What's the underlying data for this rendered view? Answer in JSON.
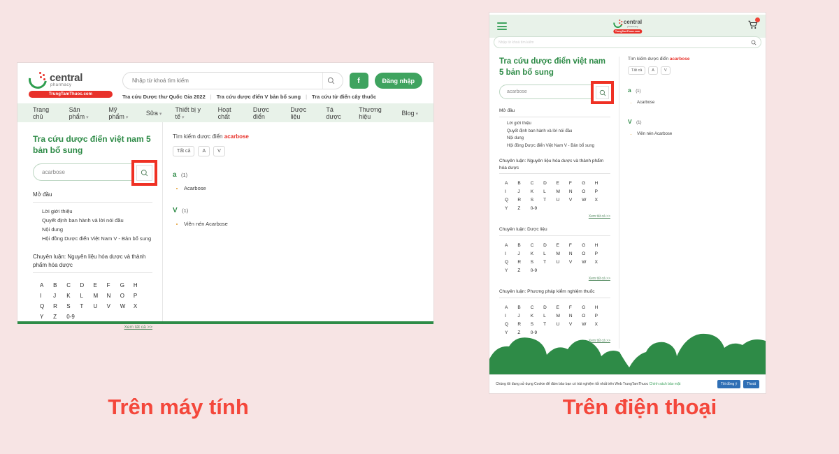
{
  "page": {
    "background_color": "#f7e4e4",
    "accent_green": "#2e8b47",
    "accent_red": "#e8312a",
    "annotation_red": "#ef3124"
  },
  "captions": {
    "desktop": "Trên máy tính",
    "mobile": "Trên điện thoại"
  },
  "brand": {
    "name": "central",
    "tagline": "pharmacy",
    "badge": "TrungTamThuoc.com"
  },
  "desktop": {
    "header": {
      "search_placeholder": "Nhập từ khoá tìm kiếm",
      "search_icon": "search-icon",
      "facebook_label": "f",
      "login_label": "Đăng nhập",
      "sublinks": [
        "Tra cứu Dược thư Quốc Gia 2022",
        "Tra cứu dược điển V bản bổ sung",
        "Tra cứu từ điển cây thuốc"
      ],
      "separator": "|"
    },
    "nav": [
      {
        "label": "Trang chủ",
        "caret": false
      },
      {
        "label": "Sản phẩm",
        "caret": true
      },
      {
        "label": "Mỹ phẩm",
        "caret": true
      },
      {
        "label": "Sữa",
        "caret": true
      },
      {
        "label": "Thiết bị y tế",
        "caret": true
      },
      {
        "label": "Hoạt chất",
        "caret": false
      },
      {
        "label": "Dược điển",
        "caret": false
      },
      {
        "label": "Dược liệu",
        "caret": false
      },
      {
        "label": "Tá dược",
        "caret": false
      },
      {
        "label": "Thương hiệu",
        "caret": false
      },
      {
        "label": "Blog",
        "caret": true
      }
    ],
    "left_panel": {
      "title": "Tra cứu dược điển việt nam 5 bản bổ sung",
      "search_value": "acarbose",
      "search_icon": "search-icon",
      "intro_heading": "Mở đầu",
      "intro_items": [
        "Lời giới thiệu",
        "Quyết định ban hành và lời nói đầu",
        "Nội dung",
        "Hội đồng Dược điển Việt Nam V - Bản bổ sung"
      ],
      "monograph_heading": "Chuyên luận: Nguyên liệu hóa dược và thành phẩm hóa dược",
      "alphabet": [
        "A",
        "B",
        "C",
        "D",
        "E",
        "F",
        "G",
        "H",
        "I",
        "J",
        "K",
        "L",
        "M",
        "N",
        "O",
        "P",
        "Q",
        "R",
        "S",
        "T",
        "U",
        "V",
        "W",
        "X",
        "Y",
        "Z",
        "0-9"
      ],
      "see_all": "Xem tất cả >>"
    },
    "right_panel": {
      "result_prefix": "Tìm kiếm dược điển",
      "query": "acarbose",
      "filters": [
        "Tất cả",
        "A",
        "V"
      ],
      "groups": [
        {
          "letter": "a",
          "count": "(1)",
          "items": [
            "Acarbose"
          ]
        },
        {
          "letter": "V",
          "count": "(1)",
          "items": [
            "Viên nén Acarbose"
          ]
        }
      ]
    }
  },
  "mobile": {
    "header": {
      "menu_icon": "hamburger-menu-icon",
      "cart_icon": "shopping-cart-icon",
      "cart_badge": "",
      "search_placeholder": "Nhập từ khoá tìm kiếm",
      "search_icon": "search-icon"
    },
    "left_panel": {
      "title": "Tra cứu dược điển việt nam 5 bản bổ sung",
      "search_value": "acarbose",
      "search_icon": "search-icon",
      "intro_heading": "Mở đầu",
      "intro_items": [
        "Lời giới thiệu",
        "Quyết định ban hành và lời nói đầu",
        "Nội dung",
        "Hội đồng Dược điển Việt Nam V - Bản bổ sung"
      ],
      "alphabet": [
        "A",
        "B",
        "C",
        "D",
        "E",
        "F",
        "G",
        "H",
        "I",
        "J",
        "K",
        "L",
        "M",
        "N",
        "O",
        "P",
        "Q",
        "R",
        "S",
        "T",
        "U",
        "V",
        "W",
        "X",
        "Y",
        "Z",
        "0-9"
      ],
      "see_all": "Xem tất cả >>",
      "sections": [
        {
          "heading": "Chuyên luận: Nguyên liệu hóa dược và thành phẩm hóa dược"
        },
        {
          "heading": "Chuyên luận: Dược liệu"
        },
        {
          "heading": "Chuyên luận: Phương pháp kiểm nghiệm thuốc"
        }
      ]
    },
    "right_panel": {
      "result_prefix": "Tìm kiếm dược điển",
      "query": "acarbose",
      "filters": [
        "Tất cả",
        "A",
        "V"
      ],
      "groups": [
        {
          "letter": "a",
          "count": "(1)",
          "items": [
            "Acarbose"
          ]
        },
        {
          "letter": "V",
          "count": "(1)",
          "items": [
            "Viên nén Acarbose"
          ]
        }
      ]
    },
    "cookie": {
      "text": "Chúng tôi đang sử dụng Cookie để đảm bảo bạn có trải nghiệm tốt nhất trên Web TrungTamThuoc",
      "link": "Chính sách bảo mật",
      "accept": "Tôi đồng ý",
      "exit": "Thoát"
    }
  }
}
